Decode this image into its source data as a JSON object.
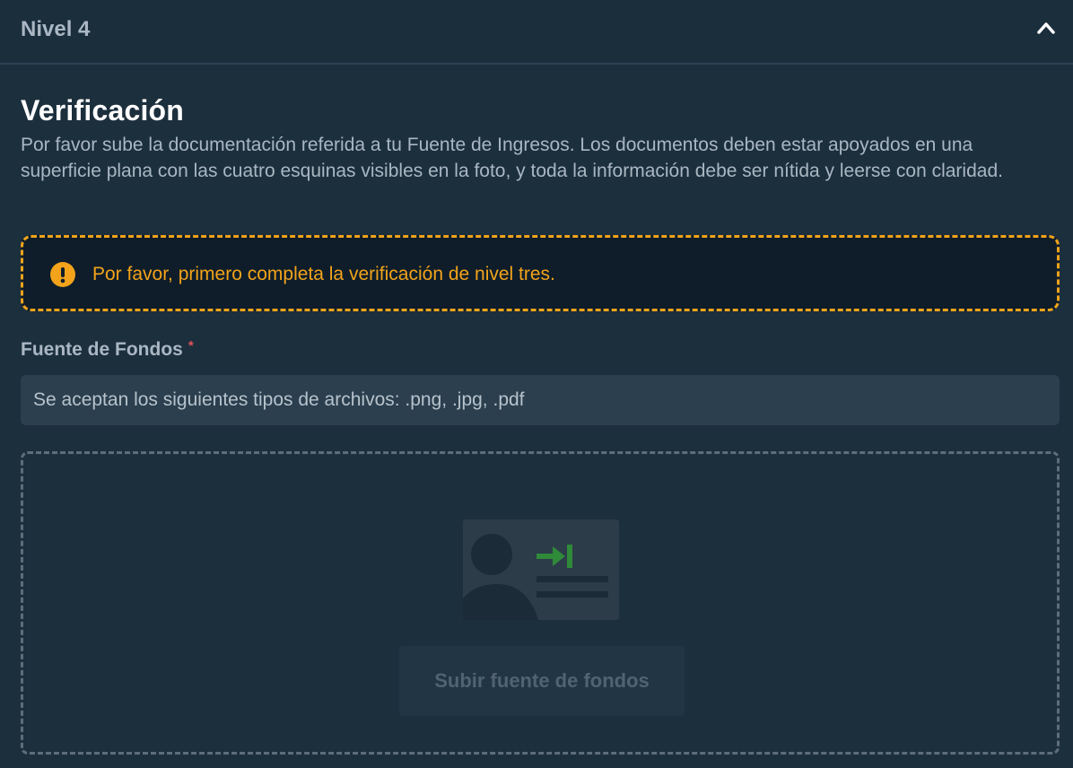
{
  "header": {
    "title": "Nivel 4",
    "toggle_icon": "chevron-up-icon"
  },
  "section": {
    "title": "Verificación",
    "description": "Por favor sube la documentación referida a tu Fuente de Ingresos. Los documentos deben estar apoyados en una superficie plana con las cuatro esquinas visibles en la foto, y toda la información debe ser nítida y leerse con claridad."
  },
  "warning": {
    "icon": "exclamation-circle-icon",
    "text": "Por favor, primero completa la verificación de nivel tres.",
    "color": "#f2a31b"
  },
  "field": {
    "label": "Fuente de Fondos",
    "required_mark": "*",
    "accepted_types": "Se aceptan los siguientes tipos de archivos: .png, .jpg, .pdf"
  },
  "upload": {
    "illustration": "id-card-icon",
    "button_label": "Subir fuente de fondos",
    "disabled": true
  },
  "colors": {
    "background": "#1c2f3d",
    "warning": "#f2a31b",
    "required": "#e0525a",
    "illustration_accent": "#2f8a3a"
  }
}
